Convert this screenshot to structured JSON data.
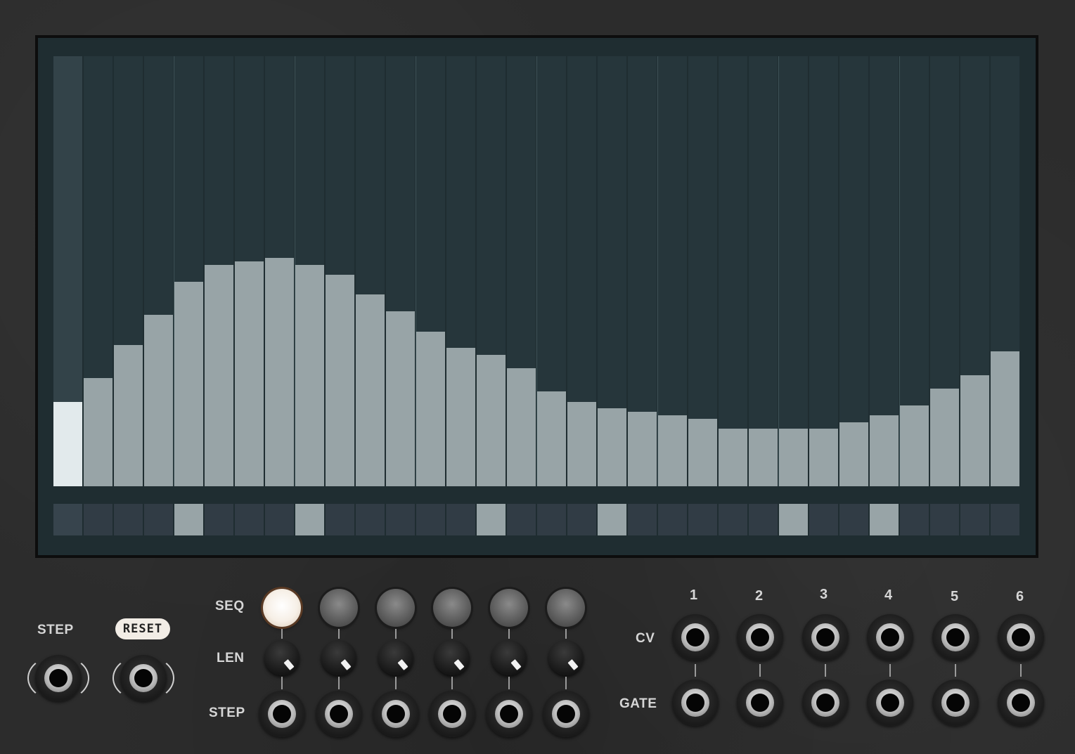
{
  "sequencer": {
    "steps": [
      0.196,
      0.251,
      0.329,
      0.399,
      0.476,
      0.515,
      0.523,
      0.531,
      0.515,
      0.492,
      0.446,
      0.407,
      0.36,
      0.322,
      0.306,
      0.275,
      0.221,
      0.196,
      0.181,
      0.173,
      0.165,
      0.157,
      0.134,
      0.134,
      0.134,
      0.134,
      0.149,
      0.165,
      0.188,
      0.227,
      0.258,
      0.313
    ],
    "active_step": 0,
    "gates": [
      0,
      0,
      0,
      0,
      1,
      0,
      0,
      0,
      1,
      0,
      0,
      0,
      0,
      0,
      1,
      0,
      0,
      0,
      1,
      0,
      0,
      0,
      0,
      0,
      1,
      0,
      0,
      1,
      0,
      0,
      0,
      0
    ],
    "colors": {
      "bar": "#98a4a7",
      "active_bar": "#e2eaec",
      "column": "#26363b",
      "gate_on": "#98a4a7",
      "gate_off": "#313c45"
    }
  },
  "left_panel": {
    "step_label": "STEP",
    "reset_label": "RESET"
  },
  "channels": {
    "seq_label": "SEQ",
    "len_label": "LEN",
    "step_label": "STEP",
    "seq_active_index": 0
  },
  "outputs": {
    "cv_label": "CV",
    "gate_label": "GATE",
    "numbers": [
      "1",
      "2",
      "3",
      "4",
      "5",
      "6"
    ]
  }
}
